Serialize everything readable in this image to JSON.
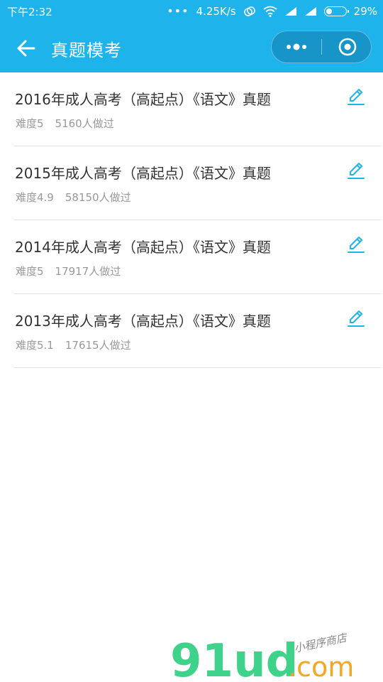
{
  "status_bar": {
    "time": "下午2:32",
    "dots": "•••",
    "speed": "4.25K/s",
    "battery": "29%"
  },
  "nav": {
    "title": "真题模考",
    "back_icon": "arrow-left-icon",
    "more_icon": "more-dots-icon",
    "close_icon": "target-circle-icon"
  },
  "exams": [
    {
      "title": "2016年成人高考（高起点）《语文》真题",
      "difficulty": "难度5",
      "done": "5160人做过"
    },
    {
      "title": "2015年成人高考（高起点）《语文》真题",
      "difficulty": "难度4.9",
      "done": "58150人做过"
    },
    {
      "title": "2014年成人高考（高起点）《语文》真题",
      "difficulty": "难度5",
      "done": "17917人做过"
    },
    {
      "title": "2013年成人高考（高起点）《语文》真题",
      "difficulty": "难度5.1",
      "done": "17615人做过"
    }
  ],
  "watermark": {
    "logo_text": "91ud",
    "domain": ".com",
    "tagline": "小程序商店"
  },
  "colors": {
    "brand": "#1fb3ec",
    "edit_icon": "#1fb3ec",
    "watermark_green": "#3fd28a",
    "watermark_orange": "#f5a623"
  }
}
